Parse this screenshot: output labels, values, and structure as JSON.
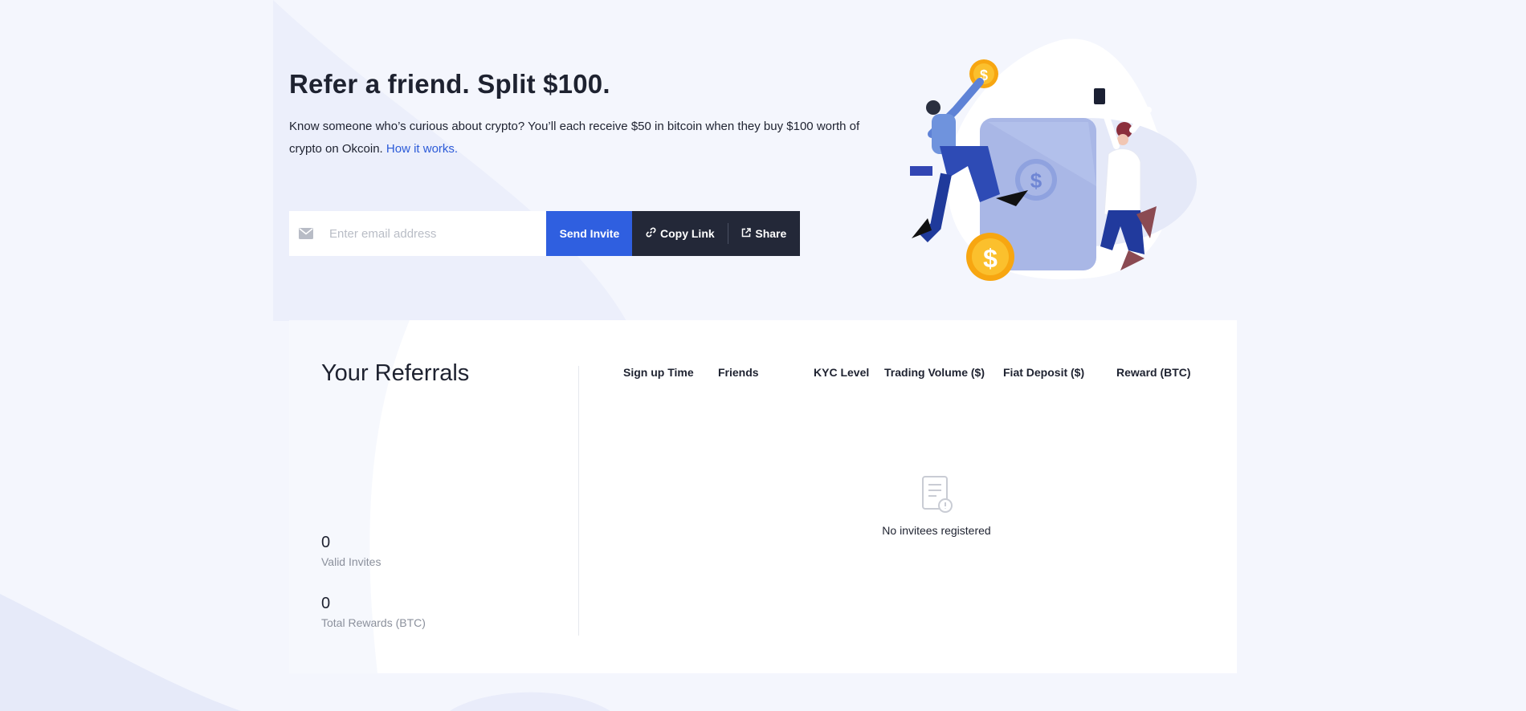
{
  "hero": {
    "title": "Refer a friend. Split $100.",
    "description": "Know someone who’s curious about crypto? You’ll each receive $50 in bitcoin when they buy $100 worth of crypto on Okcoin.",
    "link_text": "How it works."
  },
  "invite": {
    "email_placeholder": "Enter email address",
    "email_value": "",
    "send_label": "Send Invite",
    "copy_label": "Copy Link",
    "share_label": "Share"
  },
  "referrals": {
    "title": "Your Referrals",
    "valid_invites_value": "0",
    "valid_invites_label": "Valid Invites",
    "total_rewards_value": "0",
    "total_rewards_label": "Total Rewards (BTC)",
    "columns": [
      "Sign up Time",
      "Friends",
      "KYC Level",
      "Trading Volume ($)",
      "Fiat Deposit ($)",
      "Reward (BTC)"
    ],
    "empty_text": "No invitees registered"
  },
  "icons": {
    "mail": "mail-icon",
    "link": "link-icon",
    "share": "share-icon",
    "empty": "empty-document-icon"
  },
  "colors": {
    "primary": "#2f5fe0",
    "dark": "#232838",
    "link": "#2c5bd8",
    "background": "#f4f6fd"
  }
}
